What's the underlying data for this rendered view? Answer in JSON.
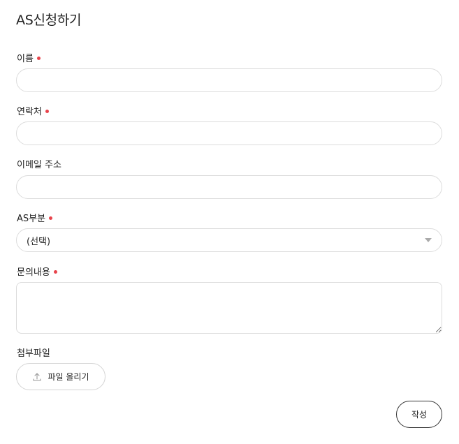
{
  "page": {
    "title": "AS신청하기"
  },
  "form": {
    "name": {
      "label": "이름",
      "required": true,
      "value": ""
    },
    "contact": {
      "label": "연락처",
      "required": true,
      "value": ""
    },
    "email": {
      "label": "이메일 주소",
      "required": false,
      "value": ""
    },
    "as_part": {
      "label": "AS부분",
      "required": true,
      "selected": "(선택)"
    },
    "inquiry": {
      "label": "문의내용",
      "required": true,
      "value": ""
    },
    "attachment": {
      "label": "첨부파일",
      "upload_label": "파일 올리기"
    },
    "submit_label": "작성"
  },
  "colors": {
    "required_dot": "#e8434b",
    "border": "#dcdcdc",
    "text": "#222222"
  },
  "icons": {
    "upload": "upload-icon",
    "select_caret": "chevron-down-icon",
    "required": "required-dot"
  }
}
